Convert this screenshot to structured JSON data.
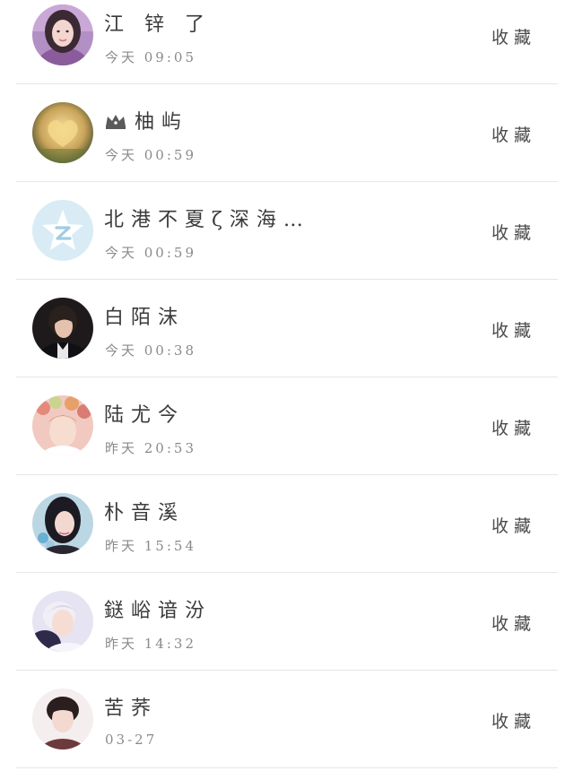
{
  "contacts": [
    {
      "name": "江 锌 了",
      "time": "今天 09:05",
      "action": "收藏",
      "avatar": "girl-portrait"
    },
    {
      "name": "柚屿",
      "time": "今天 00:59",
      "action": "收藏",
      "avatar": "heart-photo",
      "badge": "crown-icon"
    },
    {
      "name": "北港不夏ζ深海…",
      "time": "今天 00:59",
      "action": "收藏",
      "avatar": "default-star"
    },
    {
      "name": "白陌沫",
      "time": "今天 00:38",
      "action": "收藏",
      "avatar": "boy-portrait"
    },
    {
      "name": "陆尤今",
      "time": "昨天 20:53",
      "action": "收藏",
      "avatar": "floral-portrait"
    },
    {
      "name": "朴音溪",
      "time": "昨天 15:54",
      "action": "收藏",
      "avatar": "girl-portrait-2"
    },
    {
      "name": "鎹峪谙汾",
      "time": "昨天 14:32",
      "action": "收藏",
      "avatar": "boy-portrait-2"
    },
    {
      "name": "苦荞",
      "time": "03-27",
      "action": "收藏",
      "avatar": "boy-portrait-3"
    }
  ]
}
